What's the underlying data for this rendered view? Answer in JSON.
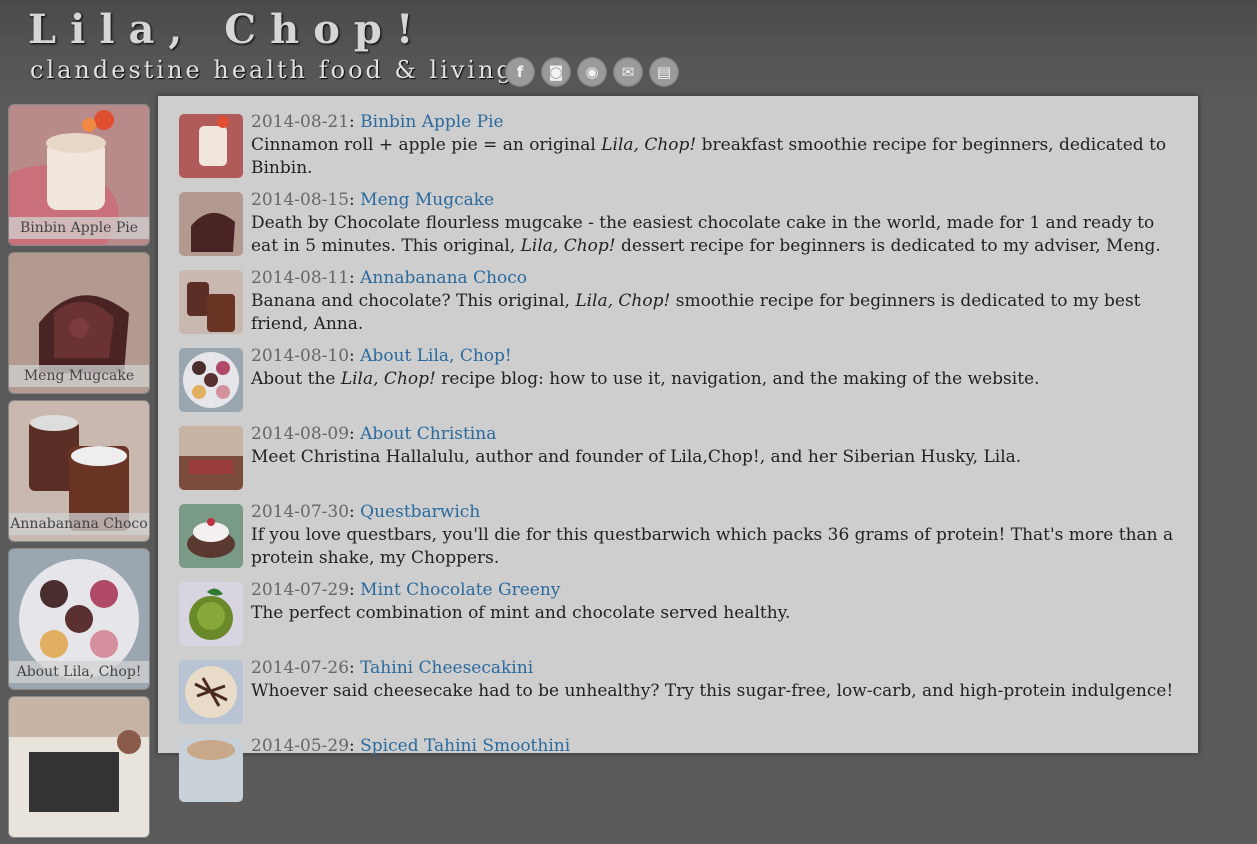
{
  "site": {
    "title": "Lila, Chop!",
    "tagline": "clandestine health food & living"
  },
  "social": [
    {
      "icon": "facebook-icon",
      "glyph": "f"
    },
    {
      "icon": "instagram-icon",
      "glyph": "◙"
    },
    {
      "icon": "rss-icon",
      "glyph": "◉"
    },
    {
      "icon": "email-icon",
      "glyph": "✉"
    },
    {
      "icon": "document-icon",
      "glyph": "▤"
    }
  ],
  "sidebar": {
    "items": [
      {
        "label": "Binbin Apple Pie"
      },
      {
        "label": "Meng Mugcake"
      },
      {
        "label": "Annabanana Choco"
      },
      {
        "label": "About Lila, Chop!"
      },
      {
        "label": ""
      }
    ]
  },
  "posts": [
    {
      "date": "2014-08-21",
      "sep": ": ",
      "title": "Binbin Apple Pie",
      "desc_pre": "Cinnamon roll + apple pie = an original ",
      "desc_em": "Lila, Chop!",
      "desc_post": " breakfast smoothie recipe for beginners, dedicated to Binbin."
    },
    {
      "date": "2014-08-15",
      "sep": ": ",
      "title": "Meng Mugcake",
      "desc_pre": "Death by Chocolate flourless mugcake - the easiest chocolate cake in the world, made for 1 and ready to eat in 5 minutes. This original, ",
      "desc_em": "Lila, Chop!",
      "desc_post": " dessert recipe for beginners is dedicated to my adviser, Meng."
    },
    {
      "date": "2014-08-11",
      "sep": ": ",
      "title": "Annabanana Choco",
      "desc_pre": "Banana and chocolate? This original, ",
      "desc_em": "Lila, Chop!",
      "desc_post": " smoothie recipe for beginners is dedicated to my best friend, Anna."
    },
    {
      "date": "2014-08-10",
      "sep": ": ",
      "title": "About Lila, Chop!",
      "desc_pre": "About the ",
      "desc_em": "Lila, Chop!",
      "desc_post": " recipe blog: how to use it, navigation, and the making of the website."
    },
    {
      "date": "2014-08-09",
      "sep": ": ",
      "title": "About Christina",
      "desc_pre": "Meet Christina Hallalulu, author and founder of Lila,Chop!, and her Siberian Husky, Lila.",
      "desc_em": "",
      "desc_post": ""
    },
    {
      "date": "2014-07-30",
      "sep": ": ",
      "title": "Questbarwich",
      "desc_pre": "If you love questbars, you'll die for this questbarwich which packs 36 grams of protein! That's more than a protein shake, my Choppers.",
      "desc_em": "",
      "desc_post": ""
    },
    {
      "date": "2014-07-29",
      "sep": ": ",
      "title": "Mint Chocolate Greeny",
      "desc_pre": "The perfect combination of mint and chocolate served healthy.",
      "desc_em": "",
      "desc_post": ""
    },
    {
      "date": "2014-07-26",
      "sep": ": ",
      "title": "Tahini Cheesecakini",
      "desc_pre": "Whoever said cheesecake had to be unhealthy? Try this sugar-free, low-carb, and high-protein indulgence!",
      "desc_em": "",
      "desc_post": ""
    },
    {
      "date": "2014-05-29",
      "sep": ": ",
      "title": "Spiced Tahini Smoothini",
      "desc_pre": "",
      "desc_em": "",
      "desc_post": ""
    }
  ],
  "colors": {
    "link": "#2a6a9e",
    "date": "#666666",
    "panel": "#cecece",
    "header": "#4f4f4f"
  }
}
